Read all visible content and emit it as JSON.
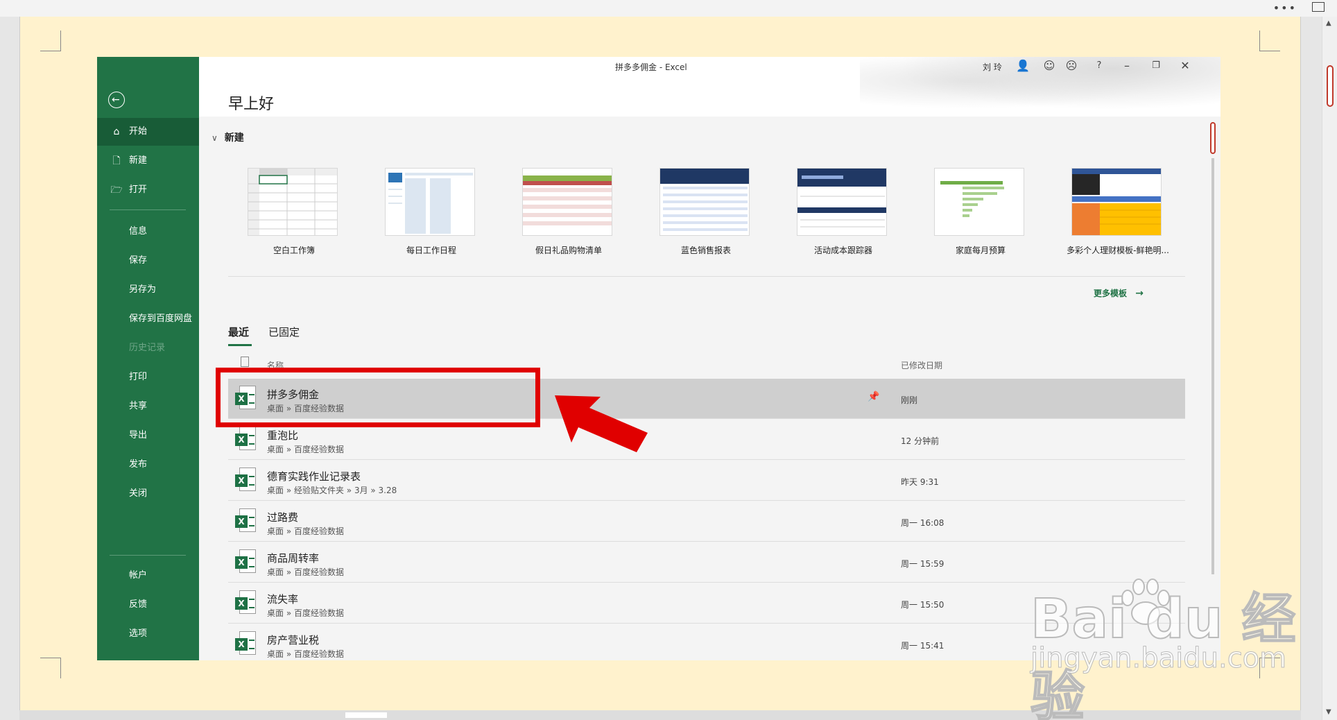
{
  "window": {
    "title": "拼多多佣金 - Excel",
    "user": "刘 玲",
    "help": "?"
  },
  "greeting": "早上好",
  "sidebar": {
    "items": [
      {
        "label": "开始",
        "icon": "home-icon"
      },
      {
        "label": "新建",
        "icon": "new-document-icon"
      },
      {
        "label": "打开",
        "icon": "open-folder-icon"
      },
      {
        "label": "信息"
      },
      {
        "label": "保存"
      },
      {
        "label": "另存为"
      },
      {
        "label": "保存到百度网盘"
      },
      {
        "label": "历史记录"
      },
      {
        "label": "打印"
      },
      {
        "label": "共享"
      },
      {
        "label": "导出"
      },
      {
        "label": "发布"
      },
      {
        "label": "关闭"
      },
      {
        "label": "帐户"
      },
      {
        "label": "反馈"
      },
      {
        "label": "选项"
      }
    ]
  },
  "new_section": {
    "title": "新建",
    "templates": [
      {
        "name": "空白工作簿"
      },
      {
        "name": "每日工作日程"
      },
      {
        "name": "假日礼品购物清单"
      },
      {
        "name": "蓝色销售报表"
      },
      {
        "name": "活动成本跟踪器"
      },
      {
        "name": "家庭每月预算"
      },
      {
        "name": "多彩个人理财模板-鲜艳明..."
      }
    ],
    "more": "更多模板"
  },
  "recent": {
    "tabs": [
      "最近",
      "已固定"
    ],
    "col_name": "名称",
    "col_date": "已修改日期",
    "files": [
      {
        "name": "拼多多佣金",
        "path": "桌面 » 百度经验数据",
        "date": "刚刚"
      },
      {
        "name": "重泡比",
        "path": "桌面 » 百度经验数据",
        "date": "12 分钟前"
      },
      {
        "name": "德育实践作业记录表",
        "path": "桌面 » 经验贴文件夹 » 3月 » 3.28",
        "date": "昨天 9:31"
      },
      {
        "name": "过路费",
        "path": "桌面 » 百度经验数据",
        "date": "周一 16:08"
      },
      {
        "name": "商品周转率",
        "path": "桌面 » 百度经验数据",
        "date": "周一 15:59"
      },
      {
        "name": "流失率",
        "path": "桌面 » 百度经验数据",
        "date": "周一 15:50"
      },
      {
        "name": "房产营业税",
        "path": "桌面 » 百度经验数据",
        "date": "周一 15:41"
      }
    ]
  },
  "watermark": {
    "brand": "Bai du 经验",
    "url": "jingyan.baidu.com"
  },
  "colors": {
    "excel_green": "#217346",
    "highlight": "#e00000"
  }
}
